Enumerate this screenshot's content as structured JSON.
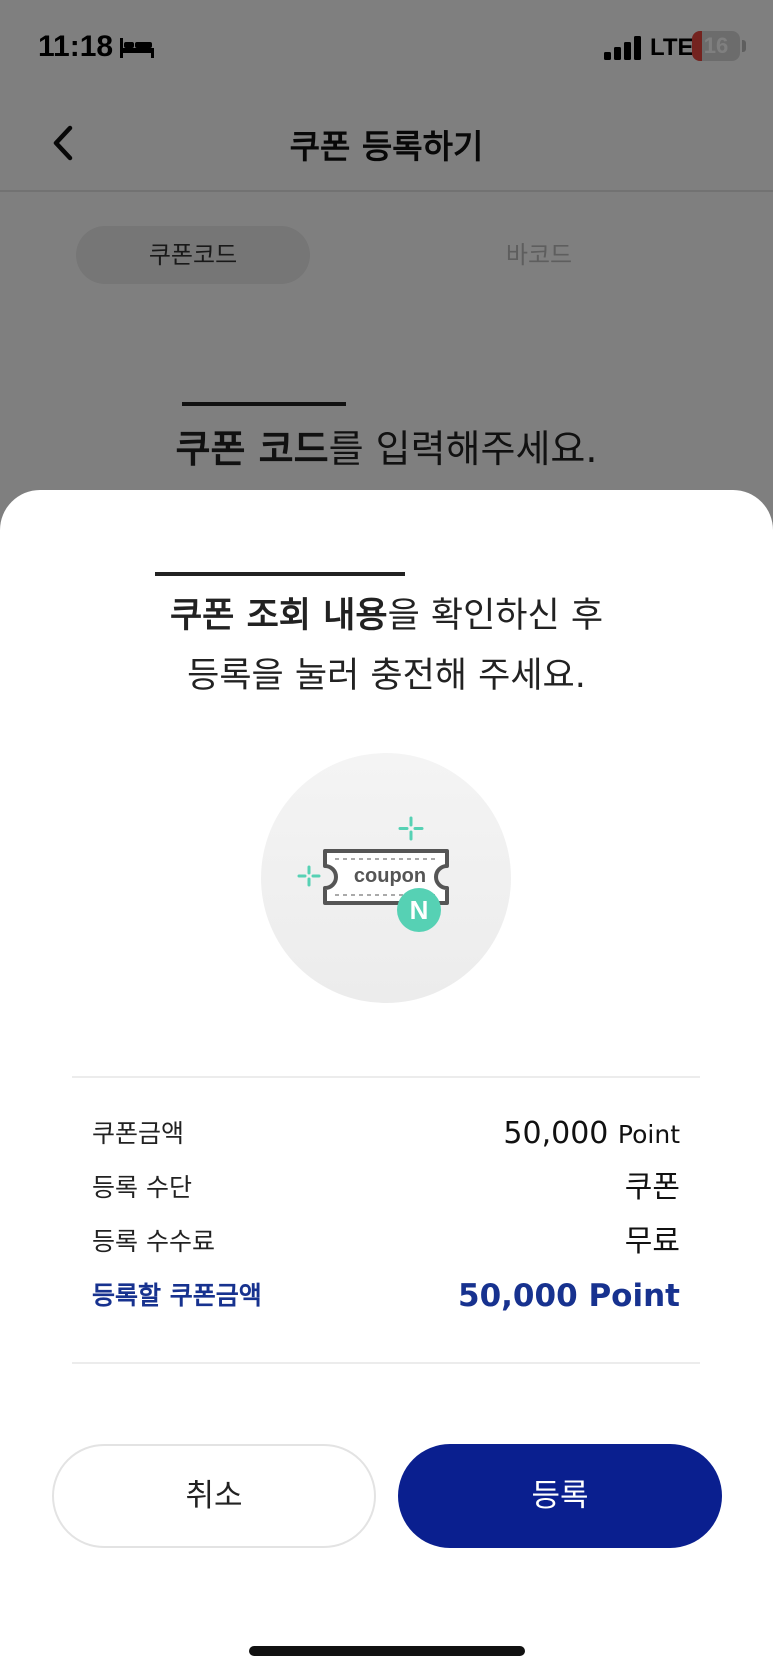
{
  "status_bar": {
    "time": "11:18",
    "network": "LTE",
    "battery": "16",
    "icons": [
      "bed-icon",
      "signal-icon",
      "battery-icon"
    ]
  },
  "nav": {
    "title": "쿠폰 등록하기",
    "back_icon": "chevron-left-icon"
  },
  "segment": {
    "tabs": [
      {
        "label": "쿠폰코드",
        "active": true
      },
      {
        "label": "바코드",
        "active": false
      }
    ]
  },
  "instruction": {
    "bold": "쿠폰 코드",
    "rest": "를 입력해주세요."
  },
  "sheet": {
    "title_bold": "쿠폰 조회 내용",
    "title_rest_line1": "을 확인하신 후",
    "title_line2": "등록을 눌러 충전해 주세요.",
    "illustration": {
      "word": "coupon",
      "badge": "N",
      "colors": {
        "accent": "#56d1b4",
        "outline": "#555555"
      }
    },
    "details": [
      {
        "label": "쿠폰금액",
        "value": "50,000",
        "unit": "Point"
      },
      {
        "label": "등록 수단",
        "value": "쿠폰",
        "unit": ""
      },
      {
        "label": "등록 수수료",
        "value": "무료",
        "unit": ""
      },
      {
        "label": "등록할 쿠폰금액",
        "value": "50,000",
        "unit": "Point",
        "highlight": true
      }
    ],
    "buttons": {
      "cancel": "취소",
      "confirm": "등록"
    }
  },
  "colors": {
    "primary": "#0a1f8f",
    "highlight_text": "#17328f",
    "accent": "#56d1b4",
    "battery_low": "#e8473e"
  }
}
